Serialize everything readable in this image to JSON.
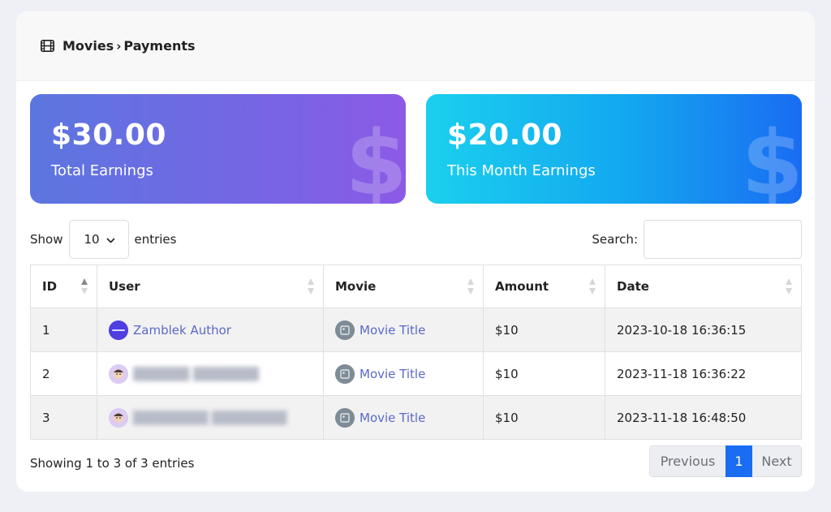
{
  "header": {
    "icon": "film-icon",
    "section": "Movies",
    "separator": "›",
    "page": "Payments"
  },
  "stats": {
    "total": {
      "amount": "$30.00",
      "label": "Total Earnings",
      "icon": "dollar-icon",
      "colors": [
        "#5c76e0",
        "#8c5ae6"
      ]
    },
    "month": {
      "amount": "$20.00",
      "label": "This Month Earnings",
      "icon": "dollar-icon",
      "colors": [
        "#1ad0ee",
        "#1a6cf2"
      ]
    }
  },
  "controls": {
    "show_label": "Show",
    "entries_value": "10",
    "entries_label": "entries",
    "search_label": "Search:",
    "search_value": ""
  },
  "table": {
    "columns": [
      "ID",
      "User",
      "Movie",
      "Amount",
      "Date"
    ],
    "rows": [
      {
        "id": "1",
        "user": "Zamblek Author",
        "movie": "Movie Title",
        "amount": "$10",
        "date": "2023-10-18 16:36:15"
      },
      {
        "id": "2",
        "user": "",
        "movie": "Movie Title",
        "amount": "$10",
        "date": "2023-11-18 16:36:22"
      },
      {
        "id": "3",
        "user": "",
        "movie": "Movie Title",
        "amount": "$10",
        "date": "2023-11-18 16:48:50"
      }
    ]
  },
  "footer": {
    "info": "Showing 1 to 3 of 3 entries",
    "prev_label": "Previous",
    "current_page": "1",
    "next_label": "Next"
  },
  "colors": {
    "accent": "#1a6cf2",
    "link": "#5b69c9"
  }
}
